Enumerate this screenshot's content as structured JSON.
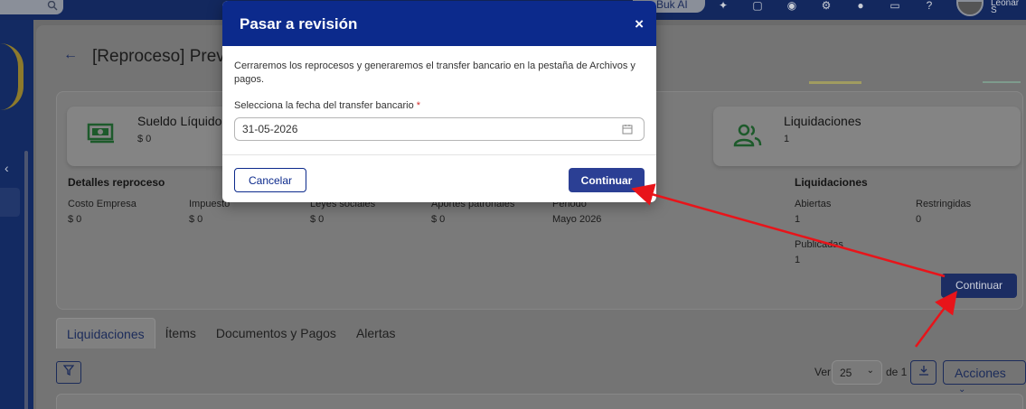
{
  "topbar": {
    "buk_ai_label": "Buk AI",
    "user_name": "Leonar S"
  },
  "page": {
    "back_arrow": "←",
    "title": "[Reproceso] Previ"
  },
  "cards": [
    {
      "title": "Sueldo Líquido",
      "value": "$ 0",
      "icon": "money-icon"
    },
    {
      "title": "Liquidaciones",
      "value": "1",
      "icon": "users-icon"
    }
  ],
  "details": {
    "title": "Detalles reproceso",
    "items": [
      {
        "label": "Costo Empresa",
        "value": "$ 0"
      },
      {
        "label": "Impuesto",
        "value": "$ 0"
      },
      {
        "label": "Leyes sociales",
        "value": "$ 0"
      },
      {
        "label": "Aportes patronales",
        "value": "$ 0"
      },
      {
        "label": "Periodo",
        "value": "Mayo 2026"
      }
    ]
  },
  "liquidaciones": {
    "title": "Liquidaciones",
    "items": [
      {
        "label": "Abiertas",
        "value": "1"
      },
      {
        "label": "Restringidas",
        "value": "0"
      },
      {
        "label": "Publicadas",
        "value": "1"
      }
    ]
  },
  "bg_continue_label": "Continuar",
  "tabs": [
    "Liquidaciones",
    "Ítems",
    "Documentos y Pagos",
    "Alertas"
  ],
  "toolbar": {
    "ver_label": "Ver",
    "per_page": "25",
    "de_label": "de 1",
    "acciones_label": "Acciones"
  },
  "modal": {
    "title": "Pasar a revisión",
    "close": "×",
    "description": "Cerraremos los reprocesos y generaremos el transfer bancario en la pestaña de Archivos y pagos.",
    "field_label": "Selecciona la fecha del transfer bancario",
    "required_mark": "*",
    "date_value": "31-05-2026",
    "cancel_label": "Cancelar",
    "continue_label": "Continuar"
  },
  "colors": {
    "modal_header": "#0c2a8c",
    "primary_button": "#2b3f94",
    "annotation_arrow": "#e8141a"
  }
}
